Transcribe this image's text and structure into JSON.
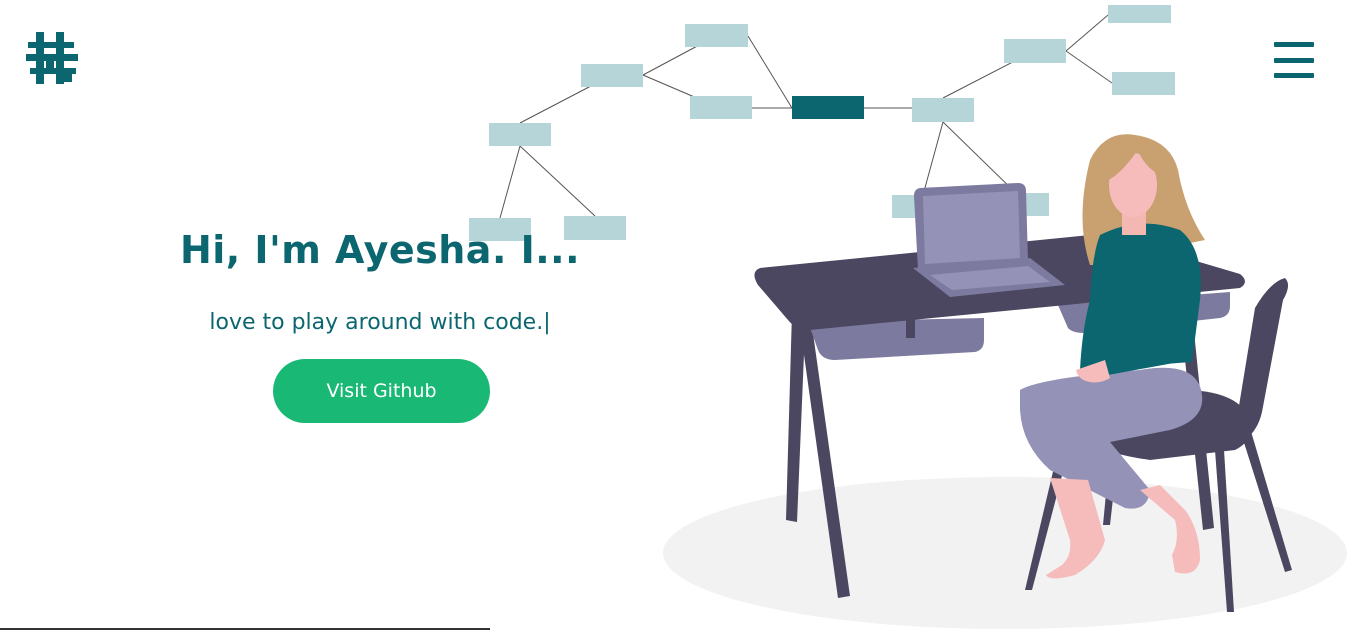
{
  "brand": {
    "logo_icon": "hash-building-logo-icon",
    "accent_color": "#0b6670"
  },
  "nav": {
    "menu_icon": "hamburger-menu-icon"
  },
  "hero": {
    "title": "Hi, I'm Ayesha. I...",
    "subtitle": "love to play around with code.|",
    "cta_label": "Visit Github",
    "cta_color": "#19b975"
  },
  "illustration": {
    "icon": "woman-at-desk-with-laptop-illustration"
  }
}
